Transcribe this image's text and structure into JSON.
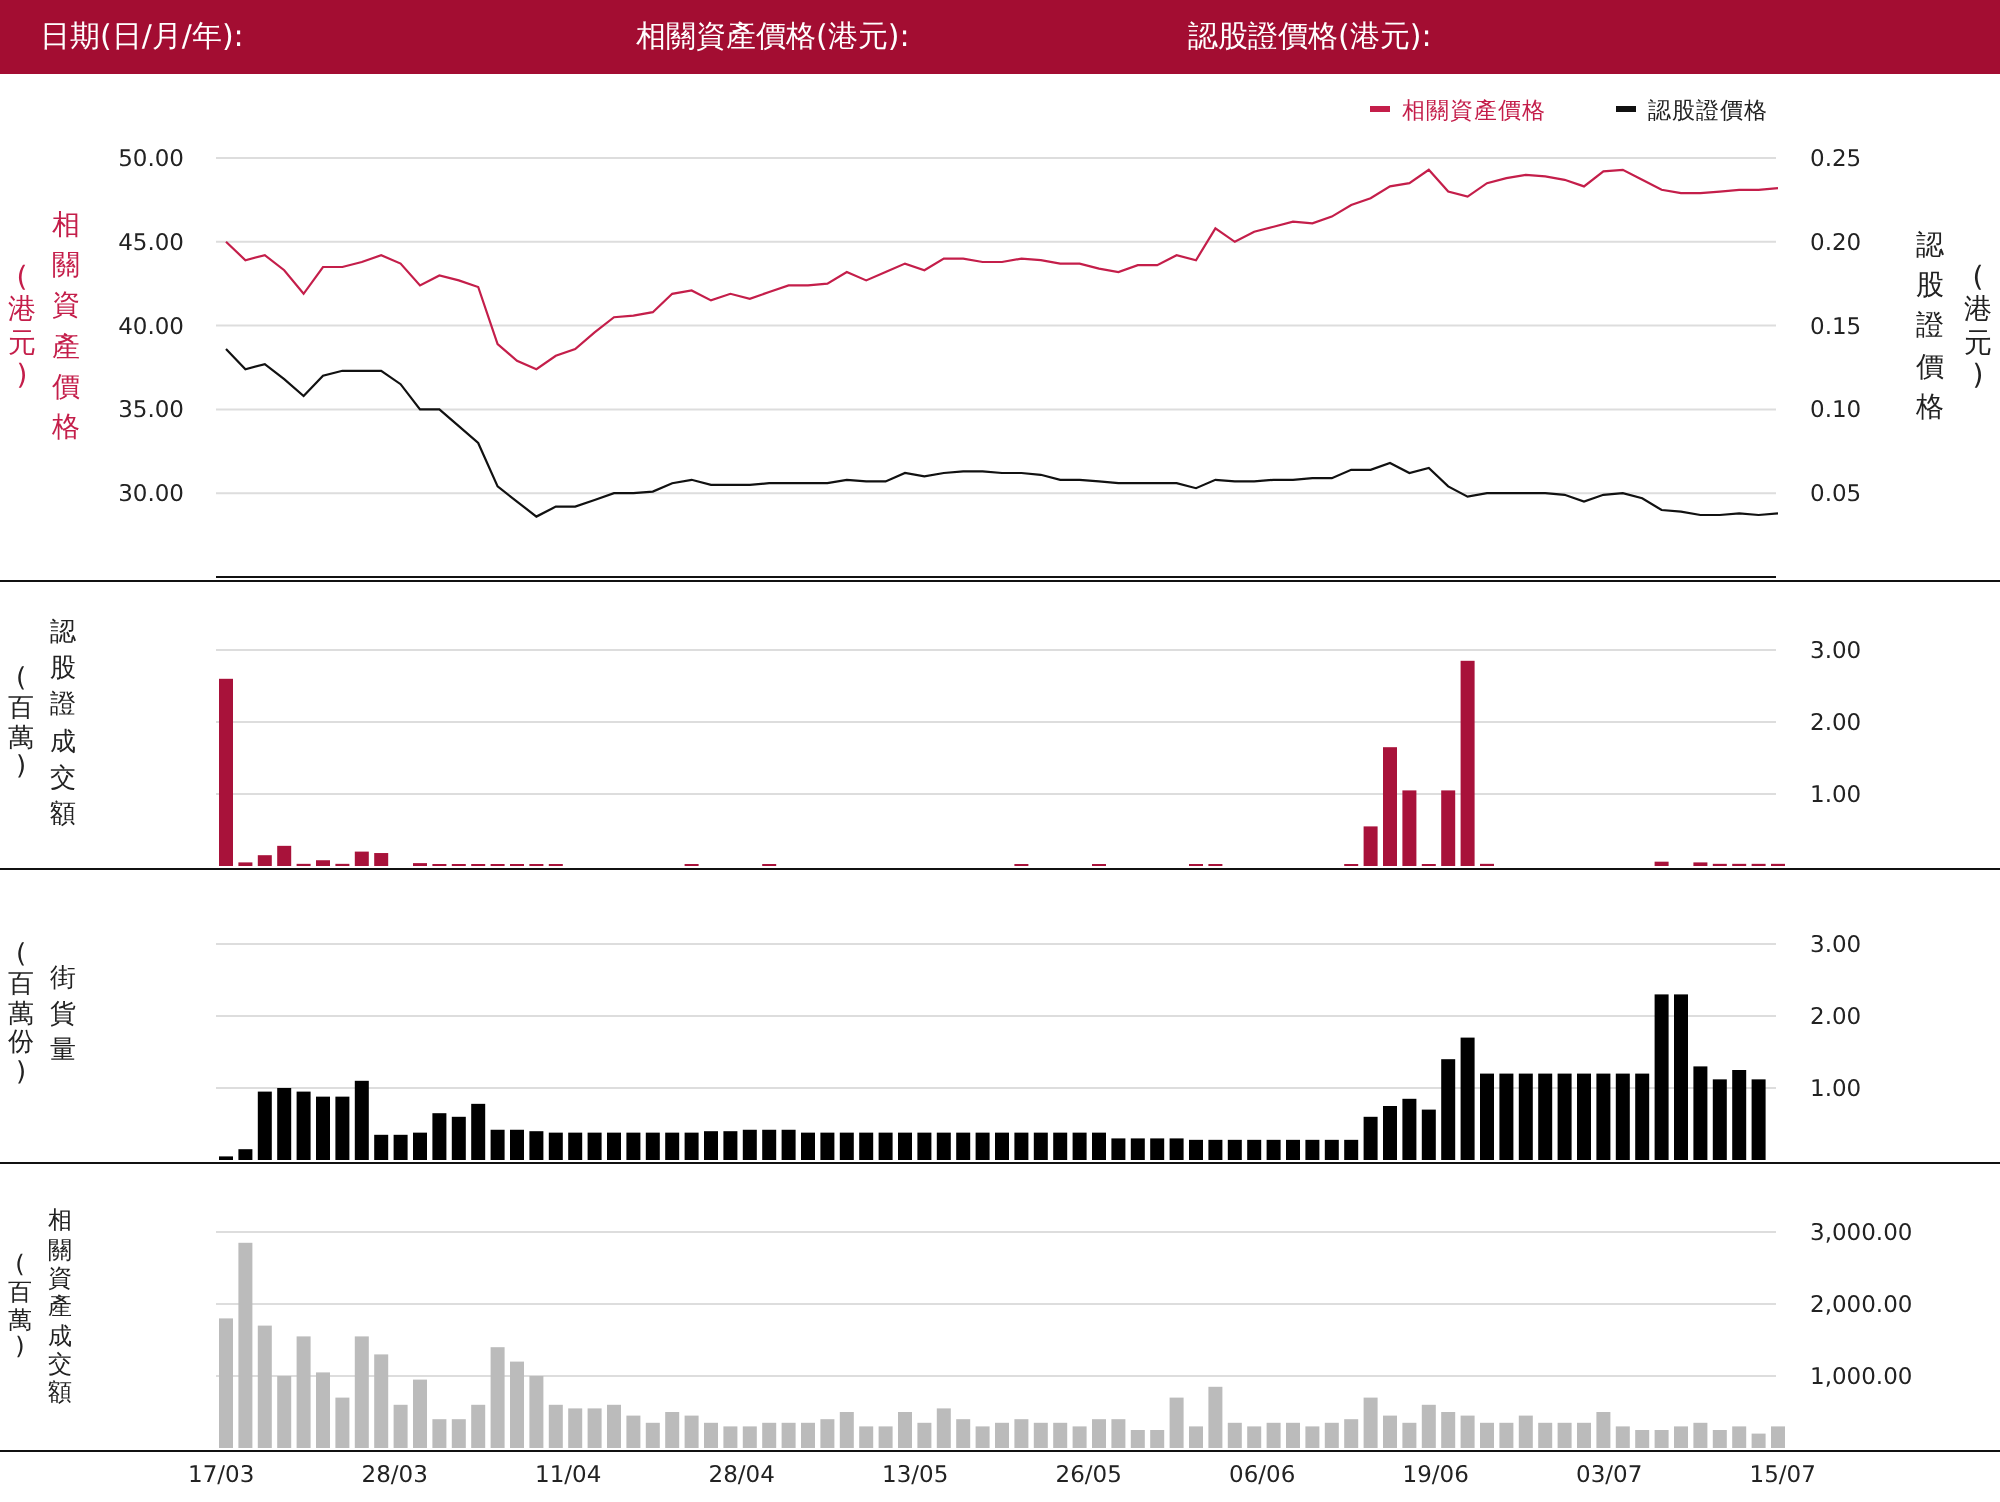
{
  "header": {
    "labels": [
      "日期(日/月/年):",
      "相關資產價格(港元):",
      "認股證價格(港元):"
    ]
  },
  "price_chart": {
    "left_title": "相關資產價格",
    "left_unit": "(港元)",
    "right_title": "認股證價格",
    "right_unit": "(港元)",
    "chart_data": {
      "type": "line",
      "grid": true,
      "legend": true,
      "ylim": [
        25,
        50
      ],
      "yticks": [
        {
          "value": 30,
          "label": "30.00"
        },
        {
          "value": 35,
          "label": "35.00"
        },
        {
          "value": 40,
          "label": "40.00"
        },
        {
          "value": 45,
          "label": "45.00"
        },
        {
          "value": 50,
          "label": "50.00"
        }
      ],
      "y2lim": [
        0,
        0.25
      ],
      "y2ticks": [
        {
          "value": 0.05,
          "label": "0.05"
        },
        {
          "value": 0.1,
          "label": "0.10"
        },
        {
          "value": 0.15,
          "label": "0.15"
        },
        {
          "value": 0.2,
          "label": "0.20"
        },
        {
          "value": 0.25,
          "label": "0.25"
        }
      ],
      "series": [
        {
          "name": "相關資產價格",
          "color": "#c41e4a",
          "values": [
            45.0,
            43.9,
            44.2,
            43.3,
            41.9,
            43.5,
            43.5,
            43.8,
            44.2,
            43.7,
            42.4,
            43.0,
            42.7,
            42.3,
            38.9,
            37.9,
            37.4,
            38.2,
            38.6,
            39.6,
            40.5,
            40.6,
            40.8,
            41.9,
            42.1,
            41.5,
            41.9,
            41.6,
            42.0,
            42.4,
            42.4,
            42.5,
            43.2,
            42.7,
            43.2,
            43.7,
            43.3,
            44.0,
            44.0,
            43.8,
            43.8,
            44.0,
            43.9,
            43.7,
            43.7,
            43.4,
            43.2,
            43.6,
            43.6,
            44.2,
            43.9,
            45.8,
            45.0,
            45.6,
            45.9,
            46.2,
            46.1,
            46.5,
            47.2,
            47.6,
            48.3,
            48.5,
            49.3,
            48.0,
            47.7,
            48.5,
            48.8,
            49.0,
            48.9,
            48.7,
            48.3,
            49.2,
            49.3,
            48.7,
            48.1,
            47.9,
            47.9,
            48.0,
            48.1,
            48.1,
            48.2
          ]
        },
        {
          "name": "認股證價格",
          "color": "#111111",
          "axis": "y2",
          "values": [
            0.136,
            0.124,
            0.127,
            0.118,
            0.108,
            0.12,
            0.123,
            0.123,
            0.123,
            0.115,
            0.1,
            0.1,
            0.09,
            0.08,
            0.054,
            0.045,
            0.036,
            0.042,
            0.042,
            0.046,
            0.05,
            0.05,
            0.051,
            0.056,
            0.058,
            0.055,
            0.055,
            0.055,
            0.056,
            0.056,
            0.056,
            0.056,
            0.058,
            0.057,
            0.057,
            0.062,
            0.06,
            0.062,
            0.063,
            0.063,
            0.062,
            0.062,
            0.061,
            0.058,
            0.058,
            0.057,
            0.056,
            0.056,
            0.056,
            0.056,
            0.053,
            0.058,
            0.057,
            0.057,
            0.058,
            0.058,
            0.059,
            0.059,
            0.064,
            0.064,
            0.068,
            0.062,
            0.065,
            0.054,
            0.048,
            0.05,
            0.05,
            0.05,
            0.05,
            0.049,
            0.045,
            0.049,
            0.05,
            0.047,
            0.04,
            0.039,
            0.037,
            0.037,
            0.038,
            0.037,
            0.038
          ]
        }
      ]
    }
  },
  "warrant_turnover_chart": {
    "left_unit": "(百萬)",
    "chart_data": {
      "type": "bar",
      "ylim": [
        0,
        3.0
      ],
      "yticks": [
        {
          "value": 1,
          "label": "1.00"
        },
        {
          "value": 2,
          "label": "2.00"
        },
        {
          "value": 3,
          "label": "3.00"
        }
      ],
      "series": [
        {
          "name": "認股證成交額",
          "color": "#a8123a",
          "values": [
            2.6,
            0.05,
            0.15,
            0.28,
            0.03,
            0.08,
            0.03,
            0.2,
            0.18,
            0,
            0.04,
            0.02,
            0.02,
            0.02,
            0.02,
            0.02,
            0.02,
            0.02,
            0,
            0,
            0,
            0,
            0,
            0,
            0.02,
            0,
            0,
            0,
            0.02,
            0,
            0,
            0,
            0,
            0,
            0,
            0,
            0,
            0,
            0,
            0,
            0,
            0.02,
            0,
            0,
            0,
            0.02,
            0,
            0,
            0,
            0,
            0.02,
            0.02,
            0,
            0,
            0,
            0,
            0,
            0,
            0.02,
            0.55,
            1.65,
            1.05,
            0.02,
            1.05,
            2.85,
            0.03,
            0,
            0,
            0,
            0,
            0,
            0,
            0,
            0,
            0.06,
            0,
            0.05,
            0.03,
            0.03,
            0.03,
            0.03
          ]
        }
      ]
    }
  },
  "outstanding_chart": {
    "left_unit": "(百萬份)",
    "chart_data": {
      "type": "bar",
      "ylim": [
        0,
        3.0
      ],
      "yticks": [
        {
          "value": 1,
          "label": "1.00"
        },
        {
          "value": 2,
          "label": "2.00"
        },
        {
          "value": 3,
          "label": "3.00"
        }
      ],
      "series": [
        {
          "name": "街貨量",
          "color": "#000000",
          "values": [
            0.05,
            0.15,
            0.95,
            1.0,
            0.95,
            0.88,
            0.88,
            1.1,
            0.35,
            0.35,
            0.38,
            0.65,
            0.6,
            0.78,
            0.42,
            0.42,
            0.4,
            0.38,
            0.38,
            0.38,
            0.38,
            0.38,
            0.38,
            0.38,
            0.38,
            0.4,
            0.4,
            0.42,
            0.42,
            0.42,
            0.38,
            0.38,
            0.38,
            0.38,
            0.38,
            0.38,
            0.38,
            0.38,
            0.38,
            0.38,
            0.38,
            0.38,
            0.38,
            0.38,
            0.38,
            0.38,
            0.3,
            0.3,
            0.3,
            0.3,
            0.28,
            0.28,
            0.28,
            0.28,
            0.28,
            0.28,
            0.28,
            0.28,
            0.28,
            0.6,
            0.75,
            0.85,
            0.7,
            1.4,
            1.7,
            1.2,
            1.2,
            1.2,
            1.2,
            1.2,
            1.2,
            1.2,
            1.2,
            1.2,
            2.3,
            2.3,
            1.3,
            1.12,
            1.25,
            1.12,
            null
          ]
        }
      ]
    }
  },
  "asset_turnover_chart": {
    "left_unit": "(百萬)",
    "x_axis_labels": [
      "17/03",
      "28/03",
      "11/04",
      "28/04",
      "13/05",
      "26/05",
      "06/06",
      "19/06",
      "03/07",
      "15/07"
    ],
    "chart_data": {
      "type": "bar",
      "ylim": [
        0,
        3000
      ],
      "yticks": [
        {
          "value": 1000,
          "label": "1,000.00"
        },
        {
          "value": 2000,
          "label": "2,000.00"
        },
        {
          "value": 3000,
          "label": "3,000.00"
        }
      ],
      "series": [
        {
          "name": "相關資產成交額",
          "color": "#bbbbbb",
          "values": [
            1800,
            2850,
            1700,
            1000,
            1550,
            1050,
            700,
            1550,
            1300,
            600,
            950,
            400,
            400,
            600,
            1400,
            1200,
            1000,
            600,
            550,
            550,
            600,
            450,
            350,
            500,
            450,
            350,
            300,
            300,
            350,
            350,
            350,
            400,
            500,
            300,
            300,
            500,
            350,
            550,
            400,
            300,
            350,
            400,
            350,
            350,
            300,
            400,
            400,
            250,
            250,
            700,
            300,
            850,
            350,
            300,
            350,
            350,
            300,
            350,
            400,
            700,
            450,
            350,
            600,
            500,
            450,
            350,
            350,
            450,
            350,
            350,
            350,
            500,
            300,
            250,
            250,
            300,
            350,
            250,
            300,
            200,
            300
          ]
        }
      ]
    }
  }
}
